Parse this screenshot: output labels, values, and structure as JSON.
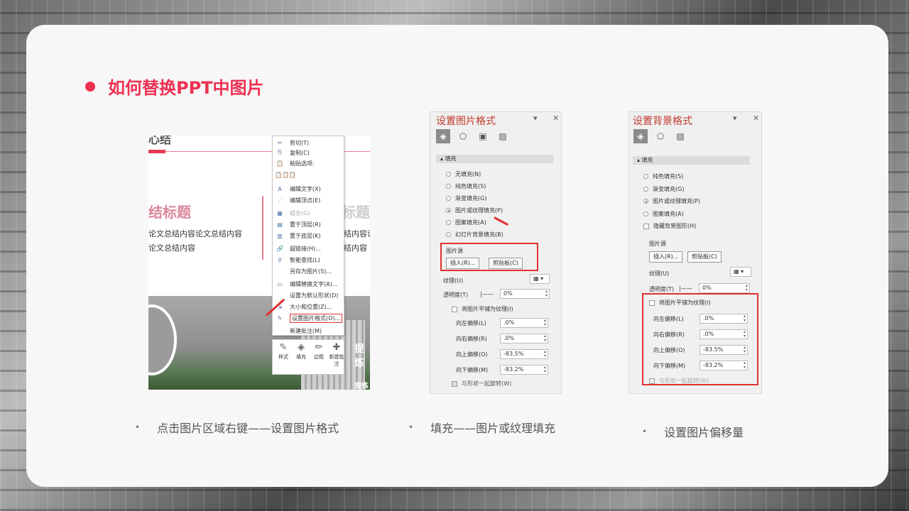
{
  "slide": {
    "title": "如何替换PPT中图片"
  },
  "shot1": {
    "heading": "心结",
    "subtitle_left": "结标题",
    "subtitle_right": "标题",
    "text_line1": "论文总结内容论文总结内容",
    "text_line2": "论文总结内容",
    "text_right1": "结内容论",
    "text_right2": "结内容",
    "photo_text1": "提炼",
    "photo_text2": "提炼",
    "menu": [
      {
        "label": "剪切(T)",
        "icon": "✂"
      },
      {
        "label": "复制(C)",
        "icon": "⎘"
      },
      {
        "label": "粘贴选项:",
        "icon": "📋"
      },
      {
        "label": "",
        "icon": "📋📋📋"
      },
      {
        "label": "编辑文字(X)",
        "icon": "A"
      },
      {
        "label": "编辑顶点(E)",
        "icon": "⋰"
      },
      {
        "label": "组合(G)",
        "icon": "▦"
      },
      {
        "label": "置于顶层(R)",
        "icon": "▤"
      },
      {
        "label": "置于底层(K)",
        "icon": "▥"
      },
      {
        "label": "超链接(H)...",
        "icon": "🔗"
      },
      {
        "label": "智能查找(L)",
        "icon": "⚲"
      },
      {
        "label": "另存为图片(S)...",
        "icon": ""
      },
      {
        "label": "编辑替换文字(A)...",
        "icon": "▭"
      },
      {
        "label": "设置为默认形状(D)",
        "icon": ""
      },
      {
        "label": "大小和位置(Z)...",
        "icon": "⇲"
      },
      {
        "label": "设置图片格式(O)...",
        "icon": "✎"
      },
      {
        "label": "新建批注(M)",
        "icon": ""
      }
    ],
    "mini_toolbar": [
      {
        "label": "样式",
        "icon": "✎"
      },
      {
        "label": "填充",
        "icon": "◈"
      },
      {
        "label": "边框",
        "icon": "✏"
      },
      {
        "label": "新建批注",
        "icon": "✚"
      }
    ]
  },
  "pane_picture": {
    "title": "设置图片格式",
    "dropdown_glyph": "▾",
    "close_glyph": "✕",
    "section_fill": "填充",
    "fill_options": [
      {
        "label": "无填充(N)",
        "on": false
      },
      {
        "label": "纯色填充(S)",
        "on": false
      },
      {
        "label": "渐变填充(G)",
        "on": false
      },
      {
        "label": "图片或纹理填充(P)",
        "on": true
      },
      {
        "label": "图案填充(A)",
        "on": false
      },
      {
        "label": "幻灯片背景填充(B)",
        "on": false
      }
    ],
    "picture_source": "图片源",
    "insert_btn": "插入(R)...",
    "clipboard_btn": "剪贴板(C)",
    "texture_label": "纹理(U)",
    "transparency_label": "透明度(T)",
    "transparency_value": "0%",
    "tile_label": "将图片平铺为纹理(I)",
    "offsets": [
      {
        "label": "向左偏移(L)",
        "value": ".0%"
      },
      {
        "label": "向右偏移(R)",
        "value": ".0%"
      },
      {
        "label": "向上偏移(O)",
        "value": "-83.5%"
      },
      {
        "label": "向下偏移(M)",
        "value": "-83.2%"
      }
    ],
    "rotate_label": "与形状一起旋转(W)"
  },
  "pane_background": {
    "title": "设置背景格式",
    "dropdown_glyph": "▾",
    "close_glyph": "✕",
    "section_fill": "填充",
    "fill_options": [
      {
        "label": "纯色填充(S)",
        "on": false
      },
      {
        "label": "渐变填充(G)",
        "on": false
      },
      {
        "label": "图片或纹理填充(P)",
        "on": true
      },
      {
        "label": "图案填充(A)",
        "on": false
      }
    ],
    "hide_bg_label": "隐藏背景图形(H)",
    "picture_source": "图片源",
    "insert_btn": "插入(R)...",
    "clipboard_btn": "剪贴板(C)",
    "texture_label": "纹理(U)",
    "transparency_label": "透明度(T)",
    "transparency_value": "0%",
    "tile_label": "将图片平铺为纹理(I)",
    "offsets": [
      {
        "label": "向左偏移(L)",
        "value": ".0%"
      },
      {
        "label": "向右偏移(R)",
        "value": ".0%"
      },
      {
        "label": "向上偏移(O)",
        "value": "-83.5%"
      },
      {
        "label": "向下偏移(M)",
        "value": "-83.2%"
      }
    ],
    "rotate_label": "与形状一起旋转(W)"
  },
  "captions": {
    "bullet": "•",
    "c1": "点击图片区域右键——设置图片格式",
    "c2": "填充——图片或纹理填充",
    "c3": "设置图片偏移量"
  },
  "colors": {
    "accent": "#ee3152",
    "highlight_box": "#e23030"
  }
}
